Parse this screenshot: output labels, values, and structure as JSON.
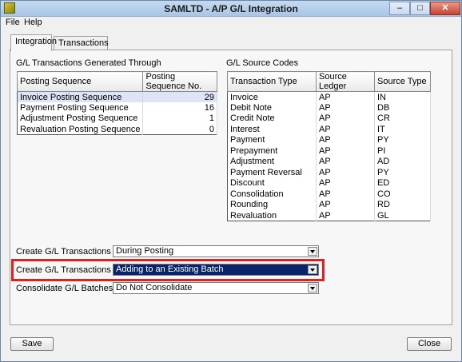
{
  "window": {
    "title": "SAMLTD - A/P G/L Integration",
    "minimize_glyph": "–",
    "maximize_glyph": "□",
    "close_glyph": "✕"
  },
  "menu": {
    "file": "File",
    "help": "Help"
  },
  "tabs": [
    {
      "label": "Integration"
    },
    {
      "label": "Transactions"
    }
  ],
  "gl_transactions": {
    "heading": "G/L Transactions Generated Through",
    "columns": [
      "Posting Sequence",
      "Posting Sequence No."
    ],
    "rows": [
      {
        "name": "Invoice Posting Sequence",
        "value": "29"
      },
      {
        "name": "Payment Posting Sequence",
        "value": "16"
      },
      {
        "name": "Adjustment Posting Sequence",
        "value": "1"
      },
      {
        "name": "Revaluation Posting Sequence",
        "value": "0"
      }
    ]
  },
  "source_codes": {
    "heading": "G/L Source Codes",
    "columns": [
      "Transaction Type",
      "Source Ledger",
      "Source Type"
    ],
    "rows": [
      {
        "type": "Invoice",
        "ledger": "AP",
        "source": "IN"
      },
      {
        "type": "Debit Note",
        "ledger": "AP",
        "source": "DB"
      },
      {
        "type": "Credit Note",
        "ledger": "AP",
        "source": "CR"
      },
      {
        "type": "Interest",
        "ledger": "AP",
        "source": "IT"
      },
      {
        "type": "Payment",
        "ledger": "AP",
        "source": "PY"
      },
      {
        "type": "Prepayment",
        "ledger": "AP",
        "source": "PI"
      },
      {
        "type": "Adjustment",
        "ledger": "AP",
        "source": "AD"
      },
      {
        "type": "Payment Reversal",
        "ledger": "AP",
        "source": "PY"
      },
      {
        "type": "Discount",
        "ledger": "AP",
        "source": "ED"
      },
      {
        "type": "Consolidation",
        "ledger": "AP",
        "source": "CO"
      },
      {
        "type": "Rounding",
        "ledger": "AP",
        "source": "RD"
      },
      {
        "type": "Revaluation",
        "ledger": "AP",
        "source": "GL"
      }
    ]
  },
  "options": {
    "create_gl_transactions": {
      "label": "Create G/L Transactions",
      "value": "During Posting"
    },
    "create_gl_transactions_by": {
      "label": "Create G/L Transactions By",
      "value": "Adding to an Existing Batch"
    },
    "consolidate_gl_batches": {
      "label": "Consolidate G/L Batches",
      "value": "Do Not Consolidate"
    }
  },
  "buttons": {
    "save": "Save",
    "close": "Close"
  },
  "colors": {
    "highlight": "#e0201c",
    "selected_combo": "#0a246a"
  }
}
